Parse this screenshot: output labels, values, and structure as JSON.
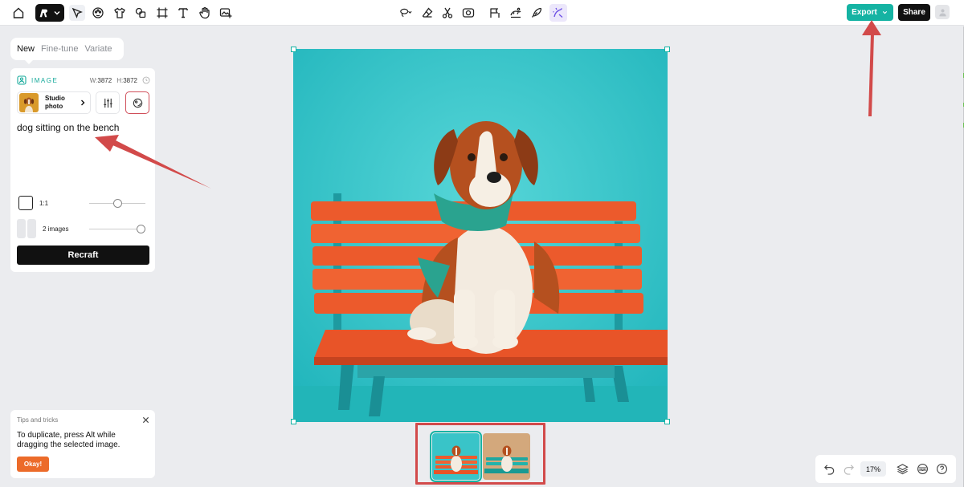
{
  "toolbar": {
    "left_tools": [
      "home-icon",
      "logo-menu",
      "select-icon",
      "palette-icon",
      "tshirt-icon",
      "shapes-icon",
      "frame-icon",
      "text-icon",
      "hand-icon",
      "add-image-icon"
    ],
    "center_tools": [
      "lasso-icon",
      "eraser-icon",
      "scissors-icon",
      "vectorize-icon",
      "mockup-icon",
      "background-remove-icon",
      "ai-edit-icon",
      "creative-upscale-icon"
    ],
    "export_label": "Export",
    "share_label": "Share"
  },
  "panel": {
    "tabs": [
      "New",
      "Fine-tune",
      "Variate"
    ],
    "active_tab": "New",
    "image_type_label": "IMAGE",
    "width_label": "W:",
    "width_value": "3872",
    "height_label": "H:",
    "height_value": "3872",
    "style_name": "Studio photo",
    "prompt": "dog sitting on the bench",
    "ratio_label": "1:1",
    "images_label": "2 images",
    "recraft_label": "Recraft",
    "ratio_slider": 0.5,
    "images_slider": 1.0
  },
  "tips": {
    "title": "Tips and tricks",
    "body": "To duplicate, press Alt while dragging the selected image.",
    "button": "Okay!"
  },
  "canvas": {
    "image_subject": "dog sitting on orange bench against teal background",
    "thumbnails": [
      {
        "subject": "dog on orange bench, teal background",
        "selected": true
      },
      {
        "subject": "dog on teal bench, beige background",
        "selected": false
      }
    ]
  },
  "bottom": {
    "zoom": "17%"
  },
  "colors": {
    "accent": "#15b3a3",
    "annotation": "#d24a4a",
    "okay_button": "#ec6b2a",
    "canvas_bg": "#ebecef"
  }
}
